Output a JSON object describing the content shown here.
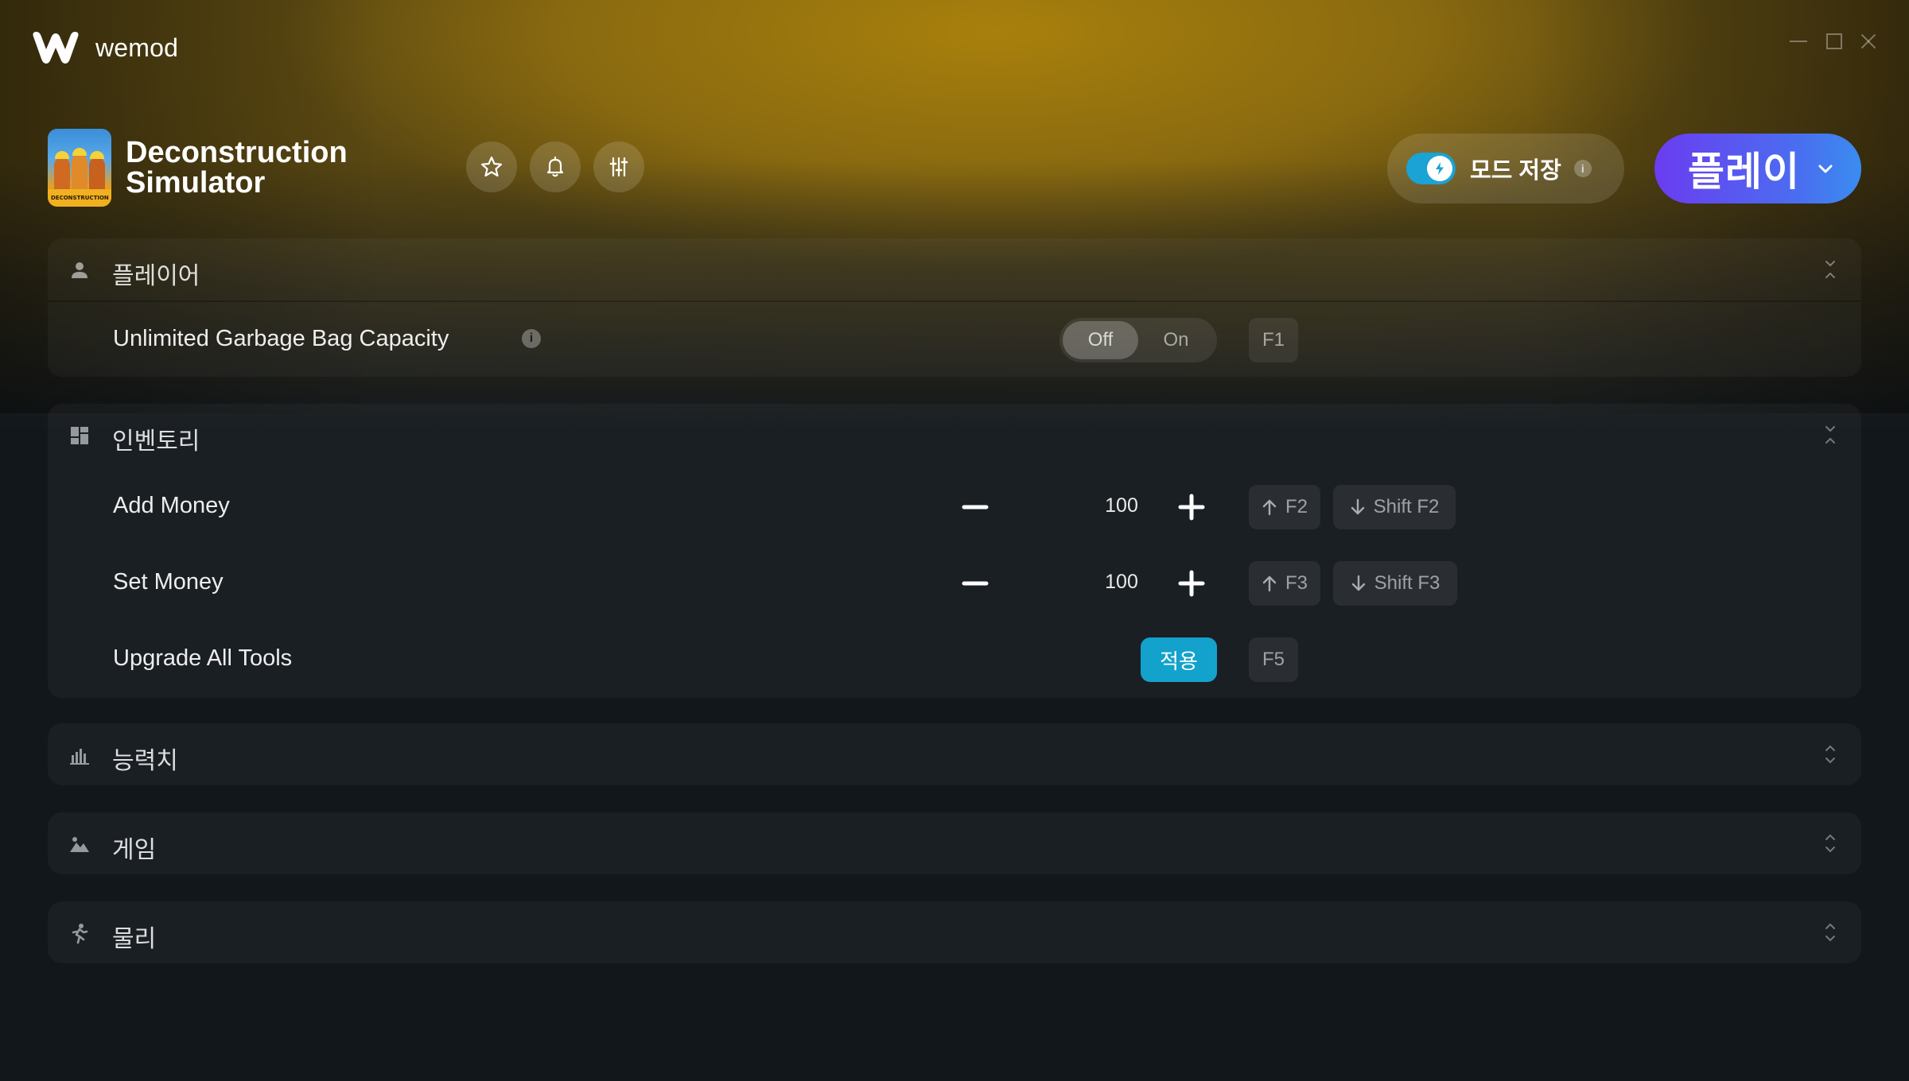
{
  "app": {
    "name": "wemod"
  },
  "game": {
    "title": "Deconstruction Simulator",
    "cover_text": "DECONSTRUCTION"
  },
  "header": {
    "save_mods_label": "모드 저장",
    "save_mods_enabled": true,
    "info_glyph": "i",
    "play_label": "플레이"
  },
  "sections": {
    "player": {
      "title": "플레이어",
      "expanded": true,
      "rows": [
        {
          "label": "Unlimited Garbage Bag Capacity",
          "type": "toggle",
          "off_label": "Off",
          "on_label": "On",
          "value": "Off",
          "hotkey": "F1",
          "info_glyph": "i"
        }
      ]
    },
    "inventory": {
      "title": "인벤토리",
      "expanded": true,
      "rows": [
        {
          "label": "Add Money",
          "type": "stepper",
          "value": "100",
          "hotkey_up": "F2",
          "hotkey_down": "Shift F2"
        },
        {
          "label": "Set Money",
          "type": "stepper",
          "value": "100",
          "hotkey_up": "F3",
          "hotkey_down": "Shift F3"
        },
        {
          "label": "Upgrade All Tools",
          "type": "button",
          "button_label": "적용",
          "hotkey": "F5"
        }
      ]
    },
    "stats": {
      "title": "능력치",
      "expanded": false
    },
    "game": {
      "title": "게임",
      "expanded": false
    },
    "physics": {
      "title": "물리",
      "expanded": false
    }
  },
  "colors": {
    "accent_toggle": "#1aa3d4",
    "apply_button": "#13a2cc",
    "play_gradient_start": "#6b3cf0",
    "play_gradient_end": "#3a8cf0",
    "background": "#12171c"
  }
}
